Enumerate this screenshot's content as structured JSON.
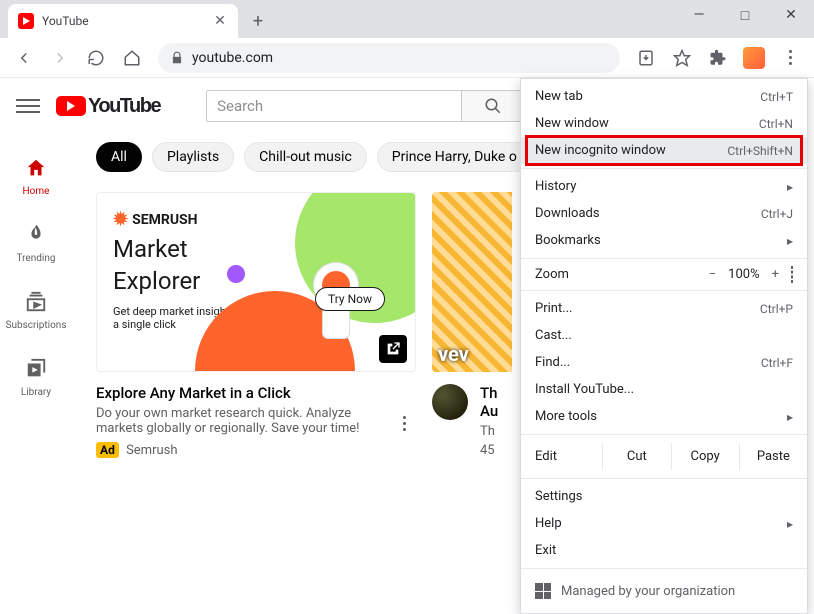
{
  "window": {
    "tab_title": "YouTube",
    "controls": {
      "min": "—",
      "max": "□",
      "close": "✕"
    }
  },
  "toolbar": {
    "address": "youtube.com"
  },
  "yt": {
    "brand": "YouTube",
    "search_placeholder": "Search",
    "rail": {
      "home": "Home",
      "trending": "Trending",
      "subscriptions": "Subscriptions",
      "library": "Library"
    },
    "chips": {
      "all": "All",
      "playlists": "Playlists",
      "chill": "Chill-out music",
      "prince": "Prince Harry, Duke o"
    },
    "ad": {
      "brand": "SEMRUSH",
      "headline1": "Market",
      "headline2": "Explorer",
      "sub": "Get deep market insights with a single click",
      "try": "Try Now",
      "title": "Explore Any Market in a Click",
      "desc": "Do your own market research quick. Analyze markets globally or regionally. Save your time!",
      "badge": "Ad",
      "sponsor": "Semrush"
    },
    "video2": {
      "title_line1": "Th",
      "title_line2": "Au",
      "meta_line1": "Th",
      "meta_line2": "45"
    }
  },
  "menu": {
    "new_tab": {
      "label": "New tab",
      "short": "Ctrl+T"
    },
    "new_window": {
      "label": "New window",
      "short": "Ctrl+N"
    },
    "incognito": {
      "label": "New incognito window",
      "short": "Ctrl+Shift+N"
    },
    "history": {
      "label": "History"
    },
    "downloads": {
      "label": "Downloads",
      "short": "Ctrl+J"
    },
    "bookmarks": {
      "label": "Bookmarks"
    },
    "zoom": {
      "label": "Zoom",
      "minus": "−",
      "value": "100%",
      "plus": "+"
    },
    "print": {
      "label": "Print...",
      "short": "Ctrl+P"
    },
    "cast": {
      "label": "Cast..."
    },
    "find": {
      "label": "Find...",
      "short": "Ctrl+F"
    },
    "install": {
      "label": "Install YouTube..."
    },
    "moretools": {
      "label": "More tools"
    },
    "edit": {
      "label": "Edit",
      "cut": "Cut",
      "copy": "Copy",
      "paste": "Paste"
    },
    "settings": {
      "label": "Settings"
    },
    "help": {
      "label": "Help"
    },
    "exit": {
      "label": "Exit"
    },
    "managed": {
      "label": "Managed by your organization"
    }
  }
}
